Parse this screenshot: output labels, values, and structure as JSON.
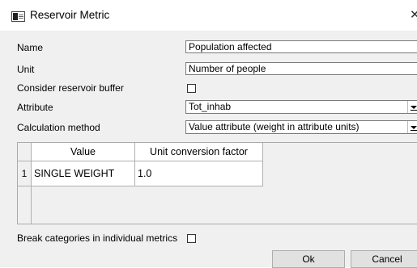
{
  "window": {
    "title": "Reservoir Metric",
    "close_glyph": "✕"
  },
  "form": {
    "name_label": "Name",
    "name_value": "Population affected",
    "unit_label": "Unit",
    "unit_value": "Number of people",
    "buffer_label": "Consider reservoir buffer",
    "buffer_checked": false,
    "attribute_label": "Attribute",
    "attribute_value": "Tot_inhab",
    "calc_label": "Calculation method",
    "calc_value": "Value attribute (weight in attribute units)"
  },
  "table": {
    "columns": [
      "Value",
      "Unit conversion factor"
    ],
    "rows": [
      {
        "index": "1",
        "value": "SINGLE WEIGHT",
        "factor": "1.0"
      }
    ]
  },
  "break_label": "Break categories in individual metrics",
  "break_checked": false,
  "buttons": {
    "ok": "Ok",
    "cancel": "Cancel"
  }
}
